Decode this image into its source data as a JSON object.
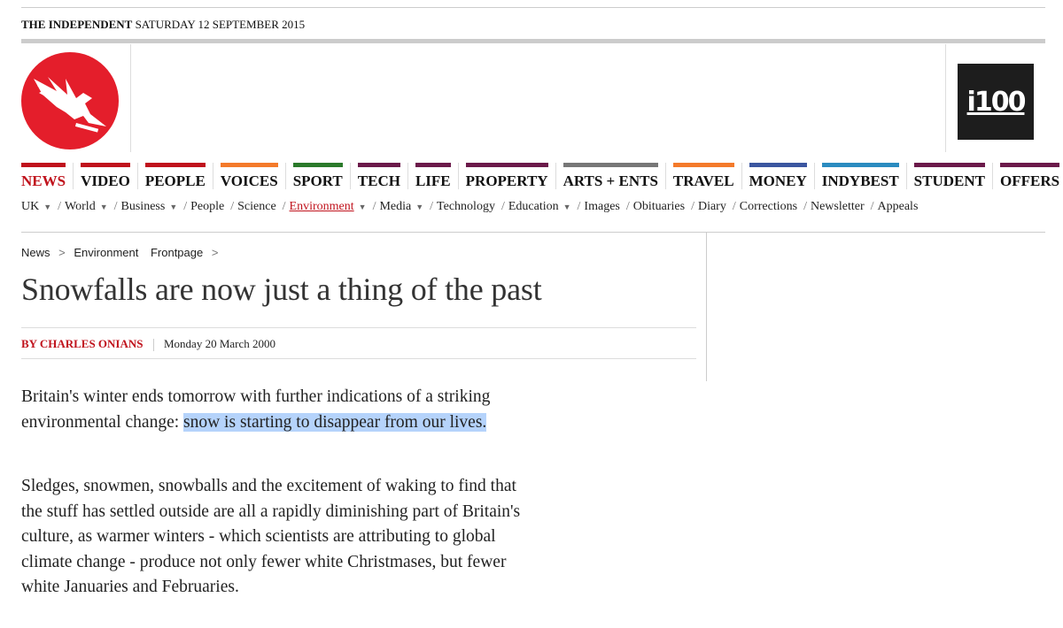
{
  "masthead": {
    "brand": "THE INDEPENDENT",
    "date": "SATURDAY 12 SEPTEMBER 2015",
    "i100_logo": "i100"
  },
  "icons": {
    "logo": "eagle-logo-icon",
    "dropdown": "caret-down-icon"
  },
  "colors": {
    "accent_red": "#c0121c",
    "logo_red": "#e41e2b",
    "highlight": "#b5d3fb"
  },
  "nav": [
    {
      "label": "NEWS",
      "color": "#c0121c",
      "active": true
    },
    {
      "label": "VIDEO",
      "color": "#c0121c"
    },
    {
      "label": "PEOPLE",
      "color": "#c0121c"
    },
    {
      "label": "VOICES",
      "color": "#f47a2a"
    },
    {
      "label": "SPORT",
      "color": "#2a7a2a"
    },
    {
      "label": "TECH",
      "color": "#6b1a4a"
    },
    {
      "label": "LIFE",
      "color": "#6b1a4a"
    },
    {
      "label": "PROPERTY",
      "color": "#6b1a4a"
    },
    {
      "label": "ARTS + ENTS",
      "color": "#777777"
    },
    {
      "label": "TRAVEL",
      "color": "#f47a2a"
    },
    {
      "label": "MONEY",
      "color": "#3b56a0"
    },
    {
      "label": "INDYBEST",
      "color": "#2a8bc0"
    },
    {
      "label": "STUDENT",
      "color": "#6b1a4a"
    },
    {
      "label": "OFFERS",
      "color": "#6b1a4a"
    }
  ],
  "subnav": [
    {
      "label": "UK",
      "dropdown": true
    },
    {
      "label": "World",
      "dropdown": true
    },
    {
      "label": "Business",
      "dropdown": true
    },
    {
      "label": "People"
    },
    {
      "label": "Science"
    },
    {
      "label": "Environment",
      "dropdown": true,
      "active": true
    },
    {
      "label": "Media",
      "dropdown": true
    },
    {
      "label": "Technology"
    },
    {
      "label": "Education",
      "dropdown": true
    },
    {
      "label": "Images"
    },
    {
      "label": "Obituaries"
    },
    {
      "label": "Diary"
    },
    {
      "label": "Corrections"
    },
    {
      "label": "Newsletter"
    },
    {
      "label": "Appeals"
    }
  ],
  "breadcrumb": {
    "items": [
      "News",
      "Environment",
      "Frontpage"
    ],
    "separator": ">"
  },
  "article": {
    "headline": "Snowfalls are now just a thing of the past",
    "author": "BY CHARLES ONIANS",
    "date": "Monday 20 March 2000",
    "p1_plain": "Britain's winter ends tomorrow with further indications of a striking environmental change: ",
    "p1_highlight": "snow is starting to disappear from our lives.",
    "p2": "Sledges, snowmen, snowballs and the excitement of waking to find that the stuff has settled outside are all a rapidly diminishing part of Britain's culture, as warmer winters - which scientists are attributing to global climate change - produce not only fewer white Christmases, but fewer white Januaries and Februaries."
  }
}
